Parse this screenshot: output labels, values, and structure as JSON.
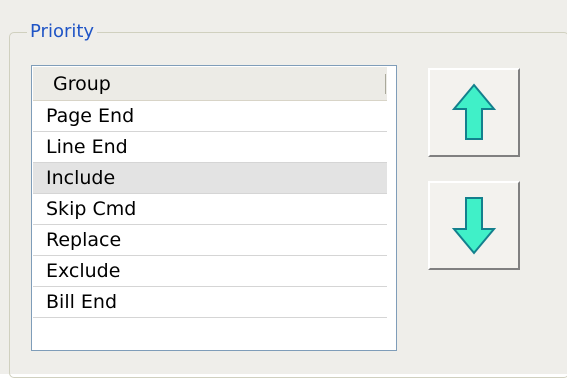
{
  "group_box": {
    "title": "Priority"
  },
  "listbox": {
    "header": "Group",
    "items": [
      "Page End",
      "Line End",
      "Include",
      "Skip Cmd",
      "Replace",
      "Exclude",
      "Bill End"
    ],
    "selected": "Include"
  },
  "buttons": {
    "move_up_icon": "arrow-up-icon",
    "move_down_icon": "arrow-down-icon",
    "arrow_fill_color": "#40f0c8",
    "arrow_stroke_color": "#13808d"
  }
}
